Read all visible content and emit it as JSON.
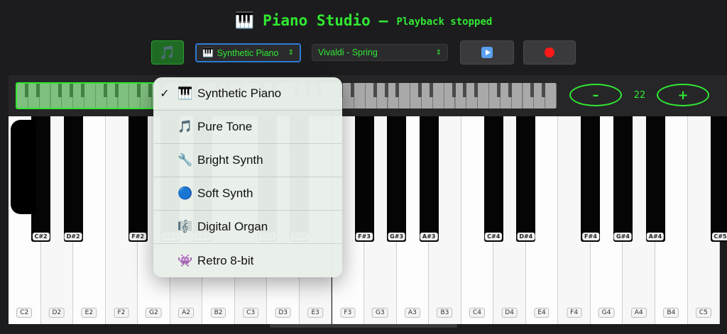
{
  "header": {
    "icon": "piano-keys-icon",
    "icon_glyph": "🎹",
    "title": "Piano Studio",
    "separator": "–",
    "status": "Playback stopped"
  },
  "toolbar": {
    "mode_glyph": "🎵",
    "instrument": {
      "icon_glyph": "🎹",
      "value": "Synthetic Piano"
    },
    "song": {
      "value": "Vivaldi - Spring"
    },
    "play_label": "",
    "record_label": ""
  },
  "range": {
    "minus_label": "–",
    "plus_label": "+",
    "value": "22"
  },
  "instrument_menu": {
    "items": [
      {
        "glyph": "🎹",
        "icon": "piano-icon",
        "label": "Synthetic Piano",
        "checked": true
      },
      {
        "glyph": "🎵",
        "icon": "music-note-icon",
        "label": "Pure Tone",
        "checked": false
      },
      {
        "glyph": "🔧",
        "icon": "wrench-icon",
        "label": "Bright Synth",
        "checked": false
      },
      {
        "glyph": "🔵",
        "icon": "blue-circle-icon",
        "label": "Soft Synth",
        "checked": false
      },
      {
        "glyph": "🎼",
        "icon": "music-score-icon",
        "label": "Digital Organ",
        "checked": false
      },
      {
        "glyph": "👾",
        "icon": "alien-monster-icon",
        "label": "Retro 8-bit",
        "checked": false
      }
    ]
  },
  "keyboard": {
    "white_keys": [
      "C2",
      "D2",
      "E2",
      "F2",
      "G2",
      "A2",
      "B2",
      "C3",
      "D3",
      "E3",
      "F3",
      "G3",
      "A3",
      "B3",
      "C4",
      "D4",
      "E4",
      "F4",
      "G4",
      "A4",
      "B4",
      "C5"
    ],
    "black_keys": [
      {
        "label": "C#2",
        "after": 0
      },
      {
        "label": "D#2",
        "after": 1
      },
      {
        "label": "F#2",
        "after": 3
      },
      {
        "label": "G#2",
        "after": 4
      },
      {
        "label": "A#2",
        "after": 5
      },
      {
        "label": "C#3",
        "after": 7
      },
      {
        "label": "D#3",
        "after": 8
      },
      {
        "label": "F#3",
        "after": 10
      },
      {
        "label": "G#3",
        "after": 11
      },
      {
        "label": "A#3",
        "after": 12
      },
      {
        "label": "C#4",
        "after": 14
      },
      {
        "label": "D#4",
        "after": 15
      },
      {
        "label": "F#4",
        "after": 17
      },
      {
        "label": "G#4",
        "after": 18
      },
      {
        "label": "A#4",
        "after": 19
      },
      {
        "label": "C#5",
        "after": 21
      }
    ]
  }
}
